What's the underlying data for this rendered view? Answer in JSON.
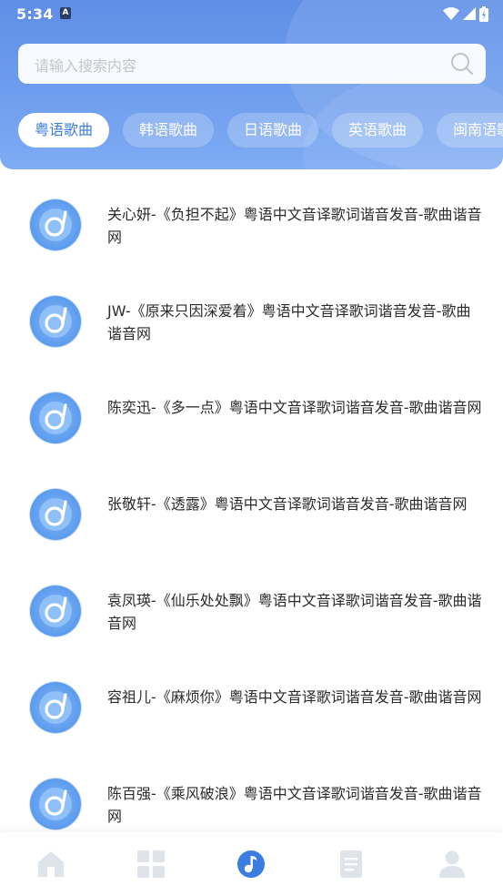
{
  "status_bar": {
    "time": "5:34",
    "notification_badge": "A"
  },
  "search": {
    "placeholder": "请输入搜索内容"
  },
  "categories": [
    {
      "label": "粤语歌曲",
      "active": true
    },
    {
      "label": "韩语歌曲",
      "active": false
    },
    {
      "label": "日语歌曲",
      "active": false
    },
    {
      "label": "英语歌曲",
      "active": false
    },
    {
      "label": "闽南语歌曲",
      "active": false
    }
  ],
  "songs": [
    {
      "title": "关心妍-《负担不起》粤语中文音译歌词谐音发音-歌曲谐音网"
    },
    {
      "title": "JW-《原来只因深爱着》粤语中文音译歌词谐音发音-歌曲谐音网"
    },
    {
      "title": "陈奕迅-《多一点》粤语中文音译歌词谐音发音-歌曲谐音网"
    },
    {
      "title": "张敬轩-《透露》粤语中文音译歌词谐音发音-歌曲谐音网"
    },
    {
      "title": "袁凤瑛-《仙乐处处飘》粤语中文音译歌词谐音发音-歌曲谐音网"
    },
    {
      "title": "容祖儿-《麻烦你》粤语中文音译歌词谐音发音-歌曲谐音网"
    },
    {
      "title": "陈百强-《乘风破浪》粤语中文音译歌词谐音发音-歌曲谐音网"
    }
  ],
  "bottom_nav": [
    {
      "icon": "home-icon",
      "active": false
    },
    {
      "icon": "grid-icon",
      "active": false
    },
    {
      "icon": "music-note-icon",
      "active": true
    },
    {
      "icon": "document-icon",
      "active": false
    },
    {
      "icon": "user-icon",
      "active": false
    }
  ],
  "colors": {
    "accent": "#3a7ce0",
    "header_gradient_top": "#5f8fe6",
    "header_gradient_bottom": "#7eabf3",
    "nav_inactive": "#dfe3ea",
    "text": "#2b2b2b"
  }
}
